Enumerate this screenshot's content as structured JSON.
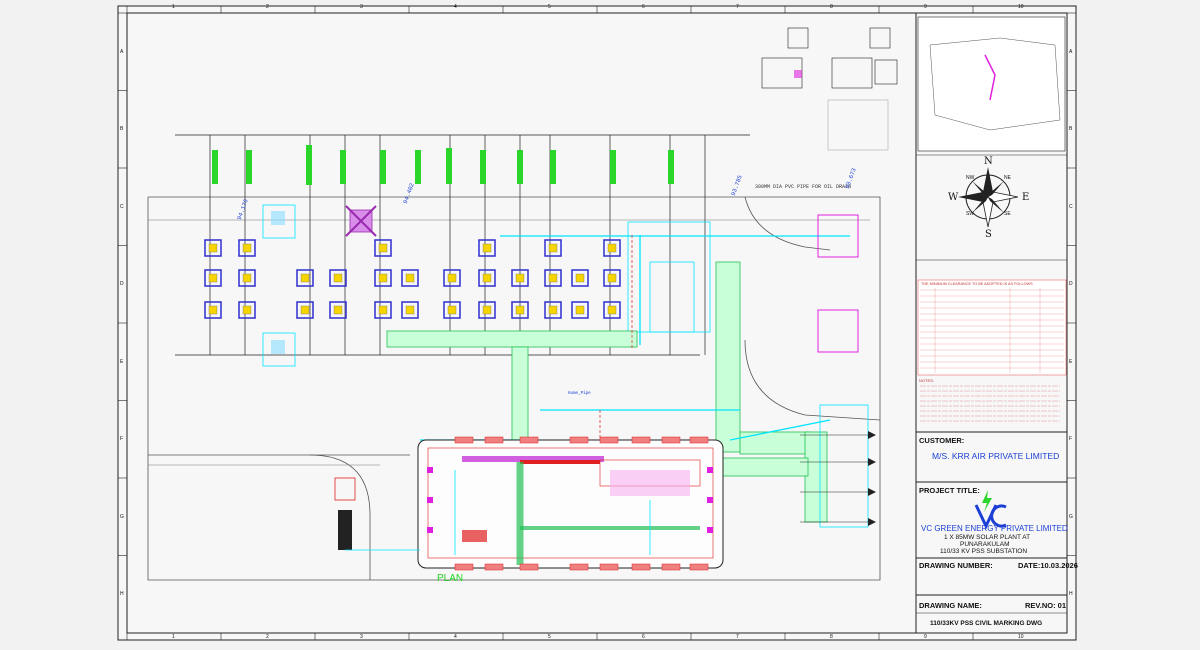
{
  "grid": {
    "columns": [
      "1",
      "2",
      "3",
      "4",
      "5",
      "6",
      "7",
      "8",
      "9",
      "10"
    ],
    "rows": [
      "A",
      "B",
      "C",
      "D",
      "E",
      "F",
      "G",
      "H"
    ]
  },
  "plan_label": "PLAN",
  "drain_label": "300MM DIA PVC PIPE FOR OIL DRAIN",
  "hume_pipe_label": "Hume_Pipe",
  "elevations": [
    "94.176",
    "94.402",
    "93.785",
    "93.673"
  ],
  "compass": {
    "n": "N",
    "s": "S",
    "e": "E",
    "w": "W",
    "ne": "NE",
    "nw": "NW",
    "se": "SE",
    "sw": "SW"
  },
  "notes_heading": "NOTES:",
  "clearance_table_title": "THE MINIMUM CLEARANCE TO BE ADOPTED IS AS FOLLOWS",
  "title_block": {
    "customer_label": "CUSTOMER:",
    "customer_name": "M/S. KRR AIR PRIVATE LIMITED",
    "project_label": "PROJECT TITLE:",
    "company_name": "VC GREEN ENERGY PRIVATE LIMITED",
    "project_line1": "1 X 85MW SOLAR PLANT AT",
    "project_line2": "PUNARAKULAM",
    "project_line3": "110/33 KV PSS SUBSTATION",
    "drawing_number_label": "DRAWING NUMBER:",
    "date_label": "DATE:10.03.2026",
    "drawing_name_label": "DRAWING NAME:",
    "rev_label": "REV.NO: 01",
    "drawing_name": "110/33KV PSS CIVIL MARKING DWG"
  },
  "colors": {
    "border": "#222222",
    "cyan": "#00e5ff",
    "green": "#2ad62a",
    "red": "#e02020",
    "magenta": "#e020e0",
    "blue": "#1c3fd6",
    "equipment": "#3a3ad0",
    "yellow": "#f5d400"
  }
}
